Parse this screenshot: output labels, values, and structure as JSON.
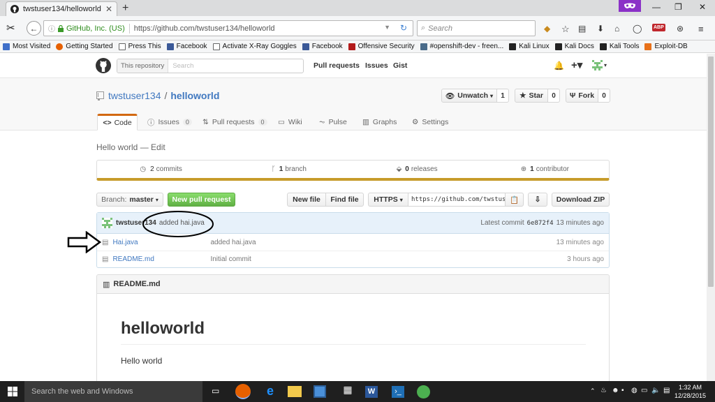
{
  "browser": {
    "tab_title": "twstuser134/helloworld",
    "identity": "GitHub, Inc. (US)",
    "url": "https://github.com/twstuser134/helloworld",
    "search_placeholder": "Search",
    "addon_badge": "ABP"
  },
  "bookmarks": [
    {
      "label": "Most Visited",
      "color": "#3f6fc9"
    },
    {
      "label": "Getting Started",
      "color": "#e66000"
    },
    {
      "label": "Press This",
      "color": "#ffffff"
    },
    {
      "label": "Facebook",
      "color": "#3b5998"
    },
    {
      "label": "Activate X-Ray Goggles",
      "color": "#ffffff"
    },
    {
      "label": "Facebook",
      "color": "#3b5998"
    },
    {
      "label": "Offensive Security",
      "color": "#b31b1b"
    },
    {
      "label": "#openshift-dev - freen...",
      "color": "#4a6b8a"
    },
    {
      "label": "Kali Linux",
      "color": "#222222"
    },
    {
      "label": "Kali Docs",
      "color": "#222222"
    },
    {
      "label": "Kali Tools",
      "color": "#222222"
    },
    {
      "label": "Exploit-DB",
      "color": "#e8711a"
    }
  ],
  "github": {
    "scope_label": "This repository",
    "search_placeholder": "Search",
    "nav": [
      "Pull requests",
      "Issues",
      "Gist"
    ],
    "owner": "twstuser134",
    "separator": "/",
    "repo": "helloworld",
    "unwatch_label": "Unwatch",
    "unwatch_count": "1",
    "star_label": "Star",
    "star_count": "0",
    "fork_label": "Fork",
    "fork_count": "0",
    "tabs": [
      {
        "label": "Code",
        "count": ""
      },
      {
        "label": "Issues",
        "count": "0"
      },
      {
        "label": "Pull requests",
        "count": "0"
      },
      {
        "label": "Wiki",
        "count": ""
      },
      {
        "label": "Pulse",
        "count": ""
      },
      {
        "label": "Graphs",
        "count": ""
      },
      {
        "label": "Settings",
        "count": ""
      }
    ],
    "description": "Hello world — Edit",
    "summary": {
      "commits_num": "2",
      "commits_label": "commits",
      "branch_num": "1",
      "branch_label": "branch",
      "releases_num": "0",
      "releases_label": "releases",
      "contrib_num": "1",
      "contrib_label": "contributor"
    },
    "branch_label": "Branch:",
    "branch_name": "master",
    "new_pr_label": "New pull request",
    "new_file_label": "New file",
    "find_file_label": "Find file",
    "protocol_label": "HTTPS",
    "clone_url": "https://github.com/twstuser134/helloworld.git",
    "download_label": "Download ZIP",
    "commit": {
      "author": "twstuser134",
      "message": "added hai.java",
      "latest_label": "Latest commit",
      "sha": "6e872f4",
      "ago": "13 minutes ago"
    },
    "files": [
      {
        "name": "Hai.java",
        "message": "added hai.java",
        "ago": "13 minutes ago"
      },
      {
        "name": "README.md",
        "message": "Initial commit",
        "ago": "3 hours ago"
      }
    ],
    "readme_title": "README.md",
    "readme_heading": "helloworld",
    "readme_body": "Hello world"
  },
  "taskbar": {
    "search_placeholder": "Search the web and Windows",
    "time": "1:32 AM",
    "date": "12/28/2015"
  }
}
